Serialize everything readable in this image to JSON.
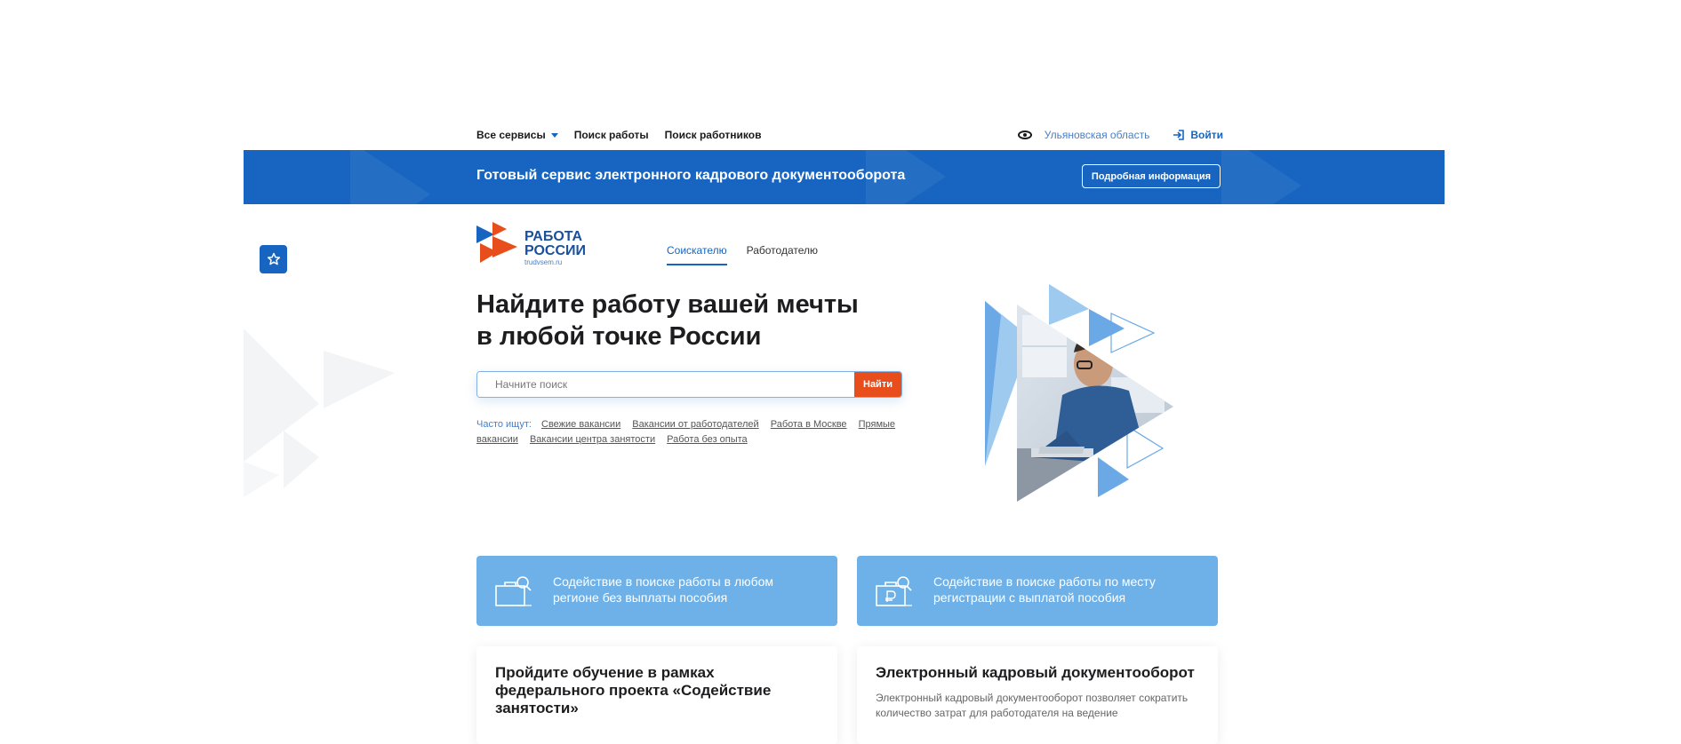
{
  "topnav": {
    "all_services": "Все сервисы",
    "job_search": "Поиск работы",
    "employee_search": "Поиск работников",
    "region": "Ульяновская область",
    "login": "Войти"
  },
  "banner": {
    "title": "Готовый сервис электронного кадрового документооборота",
    "button": "Подробная информация"
  },
  "logo": {
    "line1": "РАБОТА",
    "line2": "РОССИИ",
    "domain": "trudvsem.ru"
  },
  "tabs": [
    {
      "label": "Соискателю",
      "active": true
    },
    {
      "label": "Работодателю",
      "active": false
    }
  ],
  "hero": {
    "title_line1": "Найдите работу вашей мечты",
    "title_line2": "в любой точке России",
    "search_placeholder": "Начните поиск",
    "search_button": "Найти",
    "popular_label": "Часто ищут:",
    "popular_links": [
      "Свежие вакансии",
      "Вакансии от работодателей",
      "Работа в Москве",
      "Прямые вакансии",
      "Вакансии центра занятости",
      "Работа без опыта"
    ]
  },
  "cards": {
    "blue": [
      {
        "text": "Содействие в поиске работы в любом регионе без выплаты пособия",
        "icon": "briefcase-search-icon"
      },
      {
        "text": "Содействие в поиске работы по месту регистрации с выплатой пособия",
        "icon": "briefcase-ruble-search-icon"
      }
    ],
    "white": [
      {
        "title": "Пройдите обучение в рамках федерального проекта «Содействие занятости»",
        "desc": ""
      },
      {
        "title": "Электронный кадровый документооборот",
        "desc": "Электронный кадровый документооборот позволяет сократить количество затрат для работодателя на ведение"
      }
    ]
  },
  "colors": {
    "brand_blue": "#1765c1",
    "accent_orange": "#e84e1b",
    "card_blue": "#6db1e8"
  }
}
